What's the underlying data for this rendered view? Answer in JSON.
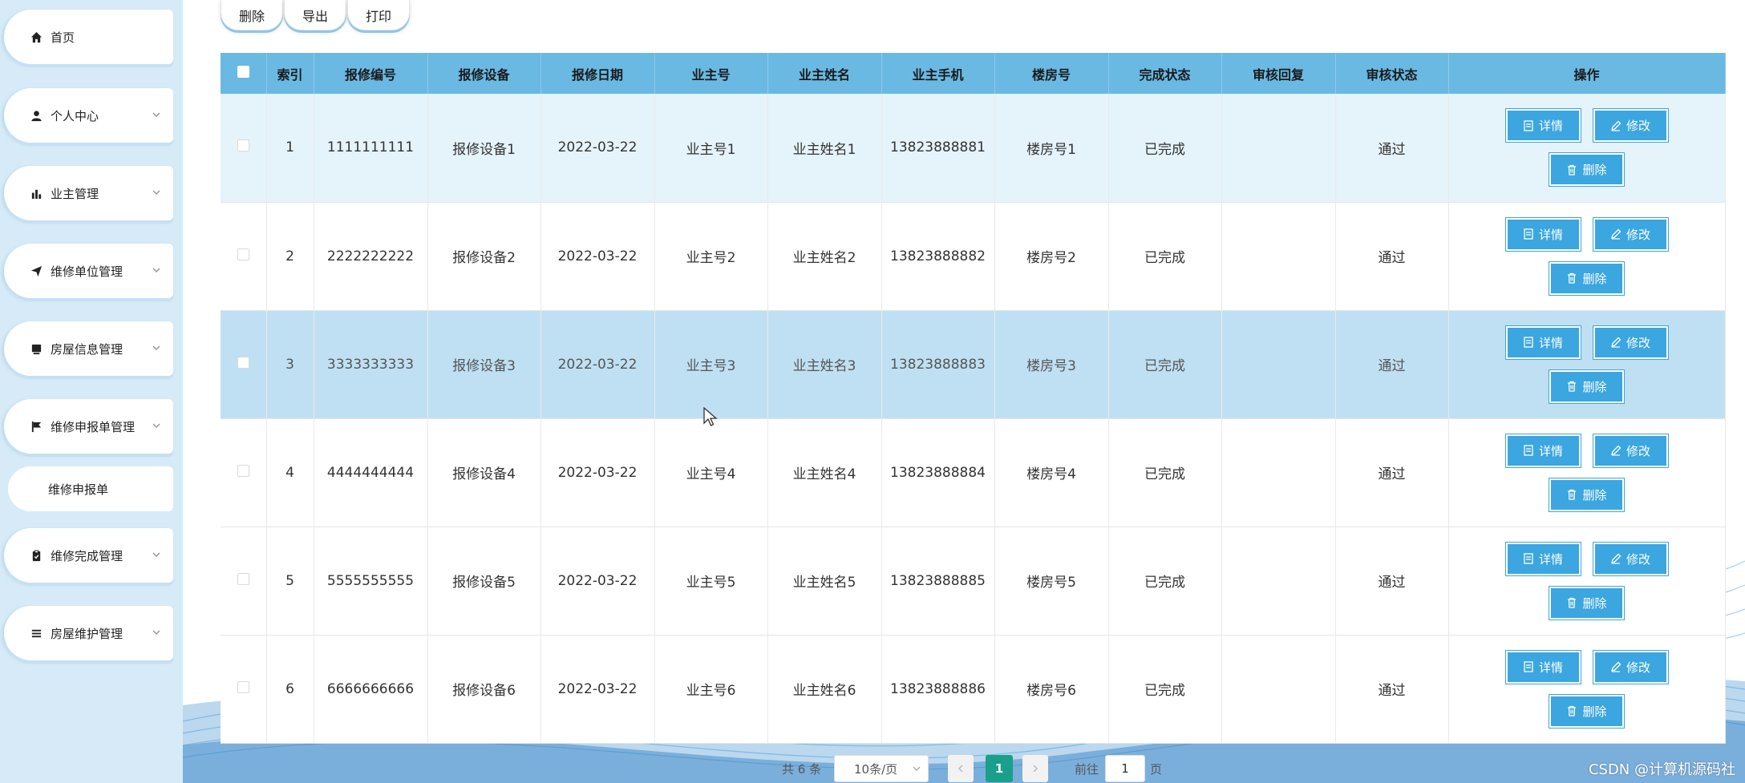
{
  "colors": {
    "sidebar_bg": "#d6ebf7",
    "header_bg": "#69b9e3",
    "button_blue": "#3ba6e0",
    "pager_active": "#1aa08a"
  },
  "sidebar": {
    "items": [
      {
        "label": "首页",
        "icon": "home-icon"
      },
      {
        "label": "个人中心",
        "icon": "user-icon"
      },
      {
        "label": "业主管理",
        "icon": "bar-chart-icon"
      },
      {
        "label": "维修单位管理",
        "icon": "send-icon"
      },
      {
        "label": "房屋信息管理",
        "icon": "card-icon"
      },
      {
        "label": "维修申报单管理",
        "icon": "flag-icon"
      },
      {
        "label": "维修完成管理",
        "icon": "clipboard-icon"
      },
      {
        "label": "房屋维护管理",
        "icon": "list-icon"
      }
    ],
    "subitem": "维修申报单"
  },
  "toolbar": {
    "delete_label": "删除",
    "export_label": "导出",
    "print_label": "打印"
  },
  "table": {
    "headers": [
      "索引",
      "报修编号",
      "报修设备",
      "报修日期",
      "业主号",
      "业主姓名",
      "业主手机",
      "楼房号",
      "完成状态",
      "审核回复",
      "审核状态",
      "操作"
    ],
    "rows": [
      {
        "index": "1",
        "code": "1111111111",
        "device": "报修设备1",
        "date": "2022-03-22",
        "owner_no": "业主号1",
        "owner_name": "业主姓名1",
        "phone": "13823888881",
        "building": "楼房号1",
        "done": "已完成",
        "reply": "",
        "audit": "通过"
      },
      {
        "index": "2",
        "code": "2222222222",
        "device": "报修设备2",
        "date": "2022-03-22",
        "owner_no": "业主号2",
        "owner_name": "业主姓名2",
        "phone": "13823888882",
        "building": "楼房号2",
        "done": "已完成",
        "reply": "",
        "audit": "通过"
      },
      {
        "index": "3",
        "code": "3333333333",
        "device": "报修设备3",
        "date": "2022-03-22",
        "owner_no": "业主号3",
        "owner_name": "业主姓名3",
        "phone": "13823888883",
        "building": "楼房号3",
        "done": "已完成",
        "reply": "",
        "audit": "通过"
      },
      {
        "index": "4",
        "code": "4444444444",
        "device": "报修设备4",
        "date": "2022-03-22",
        "owner_no": "业主号4",
        "owner_name": "业主姓名4",
        "phone": "13823888884",
        "building": "楼房号4",
        "done": "已完成",
        "reply": "",
        "audit": "通过"
      },
      {
        "index": "5",
        "code": "5555555555",
        "device": "报修设备5",
        "date": "2022-03-22",
        "owner_no": "业主号5",
        "owner_name": "业主姓名5",
        "phone": "13823888885",
        "building": "楼房号5",
        "done": "已完成",
        "reply": "",
        "audit": "通过"
      },
      {
        "index": "6",
        "code": "6666666666",
        "device": "报修设备6",
        "date": "2022-03-22",
        "owner_no": "业主号6",
        "owner_name": "业主姓名6",
        "phone": "13823888886",
        "building": "楼房号6",
        "done": "已完成",
        "reply": "",
        "audit": "通过"
      }
    ],
    "actions": {
      "detail": "详情",
      "edit": "修改",
      "delete": "删除"
    }
  },
  "pagination": {
    "total": "共 6 条",
    "page_size": "10条/页",
    "current": "1",
    "goto_label": "前往",
    "goto_value": "1",
    "page_suffix": "页"
  },
  "watermark": "CSDN @计算机源码社"
}
